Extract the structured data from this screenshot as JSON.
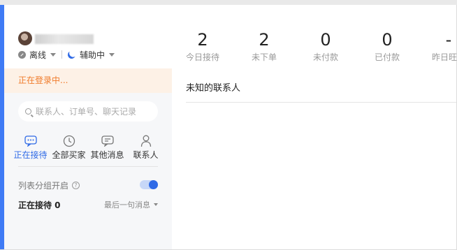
{
  "header": {
    "status": {
      "online_label": "离线",
      "assist_label": "辅助中"
    },
    "stats": [
      {
        "value": "2",
        "label": "今日接待"
      },
      {
        "value": "2",
        "label": "未下单"
      },
      {
        "value": "0",
        "label": "未付款"
      },
      {
        "value": "0",
        "label": "已付款"
      },
      {
        "value": "-",
        "label": "昨日旺旺"
      }
    ]
  },
  "sidebar": {
    "login_status": "正在登录中...",
    "search": {
      "placeholder": "联系人、订单号、聊天记录"
    },
    "tabs": [
      {
        "label": "正在接待",
        "icon": "chat-bubble-icon",
        "active": true
      },
      {
        "label": "全部买家",
        "icon": "clock-icon"
      },
      {
        "label": "其他消息",
        "icon": "message-icon"
      },
      {
        "label": "联系人",
        "icon": "person-icon"
      }
    ],
    "group_toggle_label": "列表分组开启",
    "receiving": {
      "title": "正在接待 0",
      "sort_label": "最后一句消息"
    }
  },
  "main": {
    "contact_title": "未知的联系人"
  },
  "colors": {
    "accent": "#2f6ae6",
    "warning": "#f07b2a",
    "left_edge": "#3f7bf5"
  }
}
